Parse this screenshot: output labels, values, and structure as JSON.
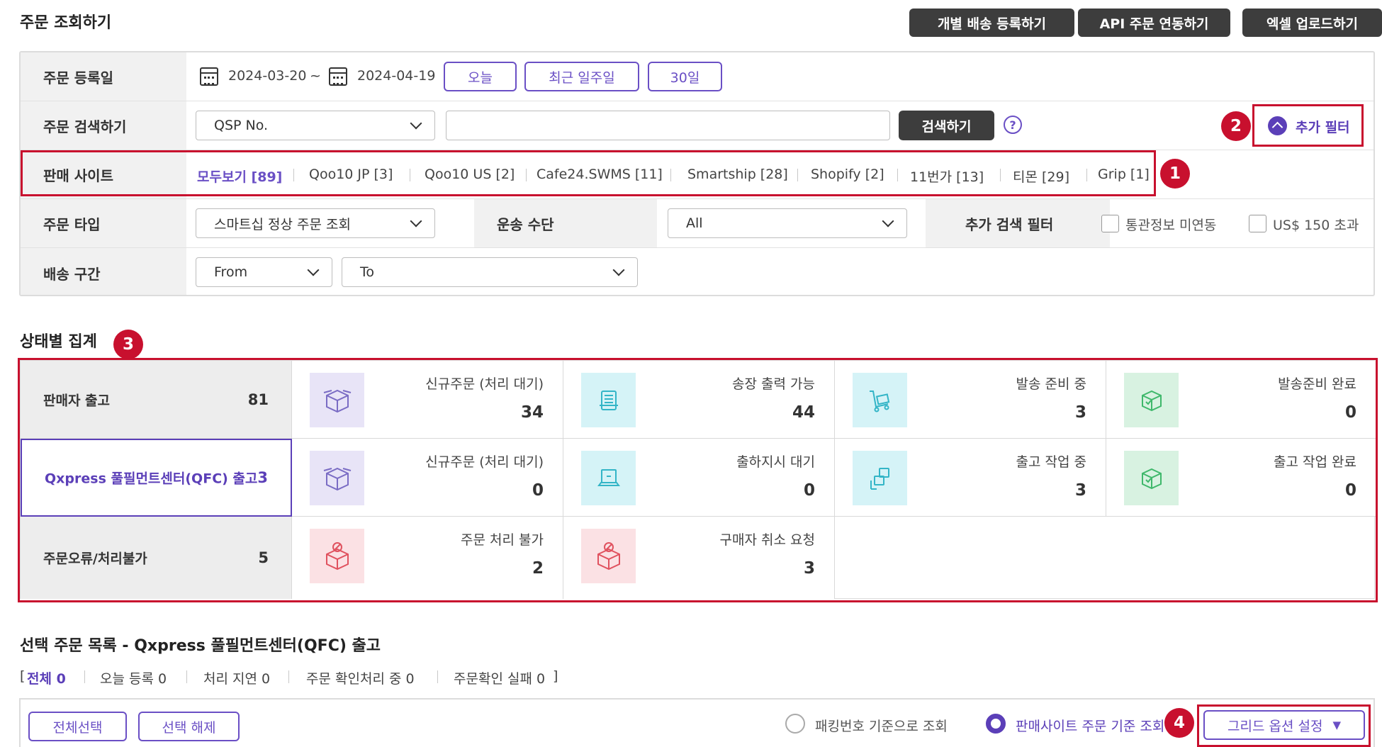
{
  "page": {
    "title": "주문 조회하기",
    "top_buttons": [
      "개별 배송 등록하기",
      "API 주문 연동하기",
      "엑셀 업로드하기"
    ]
  },
  "filters": {
    "order_date": {
      "label": "주문 등록일",
      "start": "2024-03-20",
      "sep": "~",
      "end": "2024-04-19",
      "quick_buttons": [
        "오늘",
        "최근 일주일",
        "30일"
      ]
    },
    "order_search": {
      "label": "주문 검색하기",
      "select_value": "QSP No.",
      "input_value": "",
      "search_button": "검색하기",
      "help": "?",
      "extra_filter": "추가 필터"
    },
    "sales_site": {
      "label": "판매 사이트",
      "items": [
        "모두보기 [89]",
        "Qoo10 JP [3]",
        "Qoo10 US [2]",
        "Cafe24.SWMS [11]",
        "Smartship [28]",
        "Shopify [2]",
        "11번가 [13]",
        "티몬 [29]",
        "Grip [1]"
      ]
    },
    "order_type": {
      "label": "주문 타입",
      "value": "스마트십 정상 주문 조회",
      "transport_label": "운송 수단",
      "transport_value": "All",
      "extra_label": "추가 검색 필터",
      "checkboxes": [
        "통관정보 미연동",
        "US$ 150 초과"
      ]
    },
    "shipping_range": {
      "label": "배송 구간",
      "from": "From",
      "to": "To"
    }
  },
  "annotations": [
    "1",
    "2",
    "3",
    "4"
  ],
  "status": {
    "title": "상태별 집계",
    "rows": [
      {
        "label": "판매자 출고",
        "count": "81",
        "cells": [
          {
            "title": "신규주문 (처리 대기)",
            "value": "34",
            "icon": "box-icon",
            "color": "purple"
          },
          {
            "title": "송장 출력 가능",
            "value": "44",
            "icon": "printer-icon",
            "color": "cyan"
          },
          {
            "title": "발송 준비 중",
            "value": "3",
            "icon": "cart-icon",
            "color": "cyan"
          },
          {
            "title": "발송준비 완료",
            "value": "0",
            "icon": "box-check-icon",
            "color": "green"
          }
        ]
      },
      {
        "label": "Qxpress 풀필먼트센터(QFC) 출고",
        "count": "3",
        "cells": [
          {
            "title": "신규주문 (처리 대기)",
            "value": "0",
            "icon": "box-icon",
            "color": "purple"
          },
          {
            "title": "출하지시 대기",
            "value": "0",
            "icon": "laptop-icon",
            "color": "cyan"
          },
          {
            "title": "출고 작업 중",
            "value": "3",
            "icon": "boxes-icon",
            "color": "cyan"
          },
          {
            "title": "출고 작업 완료",
            "value": "0",
            "icon": "box-check-icon",
            "color": "green"
          }
        ]
      },
      {
        "label": "주문오류/처리불가",
        "count": "5",
        "cells": [
          {
            "title": "주문 처리 불가",
            "value": "2",
            "icon": "box-error-icon",
            "color": "pink"
          },
          {
            "title": "구매자 취소 요청",
            "value": "3",
            "icon": "box-error-icon",
            "color": "pink"
          }
        ]
      }
    ]
  },
  "order_list": {
    "title": "선택 주문 목록 - Qxpress 풀필먼트센터(QFC) 출고",
    "bracket_open": "[",
    "bracket_close": "]",
    "tabs": [
      "전체 0",
      "오늘 등록 0",
      "처리 지연 0",
      "주문 확인처리 중 0",
      "주문확인 실패 0"
    ],
    "select_all": "전체선택",
    "deselect": "선택 해제",
    "radio_options": [
      "패킹번호 기준으로 조회",
      "판매사이트 주문 기준 조회"
    ],
    "grid_options": "그리드 옵션 설정"
  },
  "colors": {
    "accent": "#5b3fb8",
    "highlight": "#c8102e",
    "dark_button": "#3d3d3d"
  }
}
